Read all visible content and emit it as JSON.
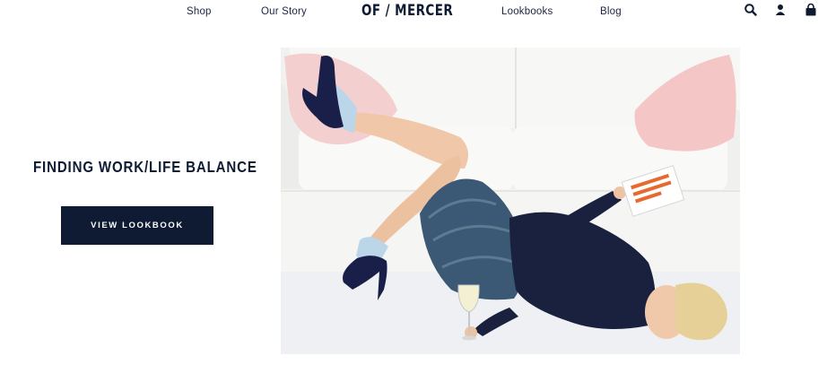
{
  "nav": {
    "shop": "Shop",
    "our_story": "Our Story",
    "logo": "OF / MERCER",
    "lookbooks": "Lookbooks",
    "blog": "Blog",
    "icons": [
      "search-icon",
      "account-icon",
      "cart-icon"
    ]
  },
  "feature": {
    "headline": "FINDING WORK/LIFE BALANCE",
    "cta_label": "VIEW LOOKBOOK"
  },
  "colors": {
    "navy": "#0f1b33",
    "white": "#ffffff"
  }
}
